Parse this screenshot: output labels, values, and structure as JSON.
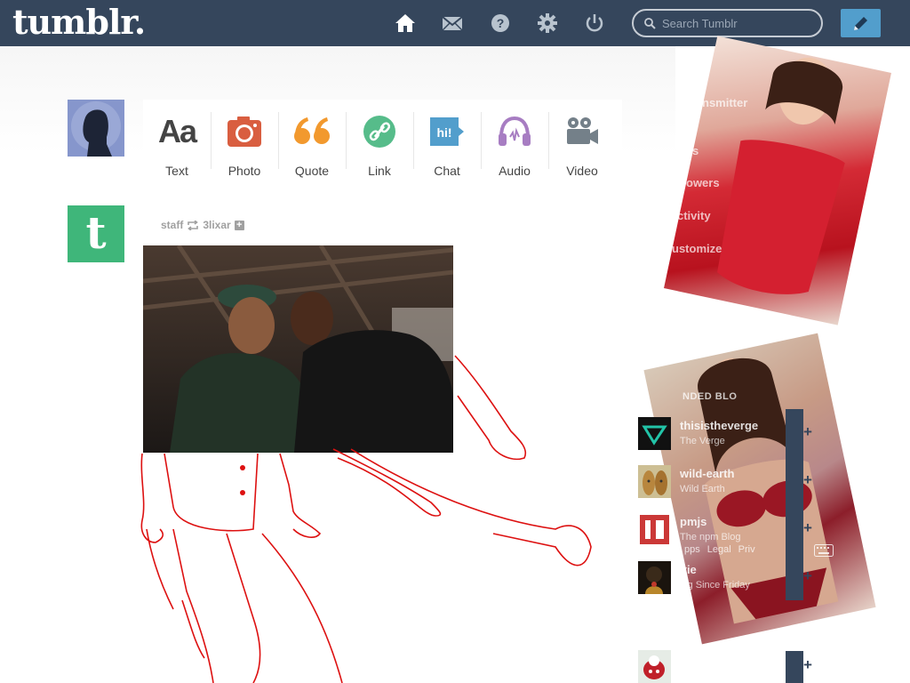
{
  "header": {
    "logo": "tumblr.",
    "search_placeholder": "Search Tumblr",
    "nav_icons": [
      "home-icon",
      "mail-icon",
      "help-icon",
      "gear-icon",
      "power-icon"
    ],
    "compose_icon": "pencil-icon"
  },
  "post_types": [
    {
      "label": "Text",
      "icon": "text-icon",
      "color": "#444444"
    },
    {
      "label": "Photo",
      "icon": "camera-icon",
      "color": "#d95e40"
    },
    {
      "label": "Quote",
      "icon": "quote-icon",
      "color": "#f2992e"
    },
    {
      "label": "Link",
      "icon": "link-icon",
      "color": "#56bc8a"
    },
    {
      "label": "Chat",
      "icon": "chat-icon",
      "color": "#529ecc"
    },
    {
      "label": "Audio",
      "icon": "headphones-icon",
      "color": "#a77dc2"
    },
    {
      "label": "Video",
      "icon": "video-camera-icon",
      "color": "#748089"
    }
  ],
  "post": {
    "author": "staff",
    "reblogged_from": "3lixar",
    "reblog_icon": "reblog-icon"
  },
  "sidebar": {
    "dashboard_links": [
      "nsmitter",
      "s",
      "owers",
      "ctivity",
      "ustomize"
    ],
    "recommended_title": "NDED BLO",
    "recommended": [
      {
        "name": "thisistheverge",
        "sub": "The Verge"
      },
      {
        "name": "wild-earth",
        "sub": "Wild Earth"
      },
      {
        "name": "pmjs",
        "sub": "The npm Blog"
      },
      {
        "name": "itie",
        "sub": "ing Since Friday"
      }
    ],
    "footer_links": [
      "pps",
      "Legal",
      "Priv"
    ]
  },
  "colors": {
    "header_bg": "#35465c",
    "compose_bg": "#529ecc",
    "staff_avatar": "#3fb67a",
    "sketch_stroke": "#dd1111"
  }
}
